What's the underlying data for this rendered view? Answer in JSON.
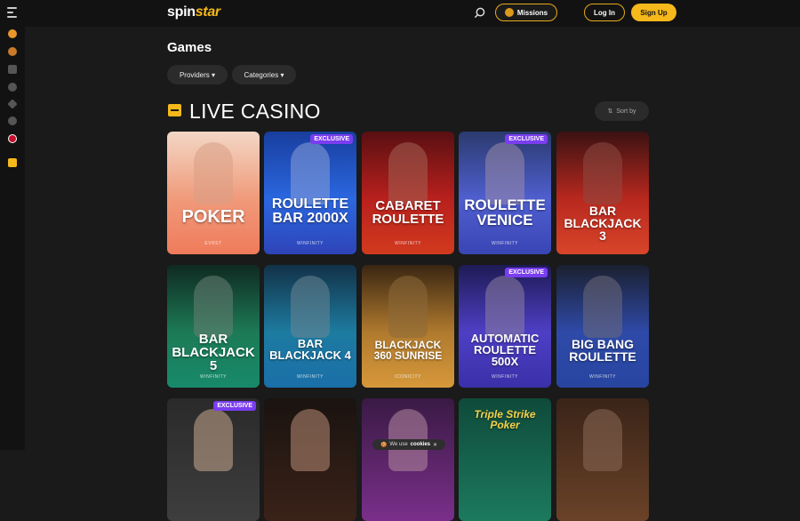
{
  "header": {
    "logo_part1": "spin",
    "logo_part2": "star",
    "missions_label": "Missions",
    "login_label": "Log In",
    "signup_label": "Sign Up"
  },
  "sidebar": {
    "icons": [
      "basketball-icon",
      "coin-icon",
      "grid-icon",
      "circle-icon",
      "diamond-icon",
      "chat-icon",
      "uk-flag-icon",
      "box-icon"
    ]
  },
  "main": {
    "title": "Games",
    "providers_label": "Providers",
    "categories_label": "Categories",
    "section_title": "LIVE CASINO",
    "sort_label": "Sort by"
  },
  "games": [
    {
      "title": "POKER",
      "brand": "EVRST",
      "badge": ""
    },
    {
      "title": "ROULETTE BAR 2000X",
      "brand": "WINFINITY",
      "badge": "EXCLUSIVE"
    },
    {
      "title": "CABARET ROULETTE",
      "brand": "WINFINITY",
      "badge": ""
    },
    {
      "title": "ROULETTE VENICE",
      "brand": "WINFINITY",
      "badge": "EXCLUSIVE"
    },
    {
      "title": "BAR BLACKJACK 3",
      "brand": "",
      "badge": ""
    },
    {
      "title": "BAR BLACKJACK 5",
      "brand": "WINFINITY",
      "badge": ""
    },
    {
      "title": "BAR BLACKJACK 4",
      "brand": "WINFINITY",
      "badge": ""
    },
    {
      "title": "BLACKJACK 360 SUNRISE",
      "brand": "ICONICITY",
      "badge": ""
    },
    {
      "title": "AUTOMATIC ROULETTE 500X",
      "brand": "WINFINITY",
      "badge": "EXCLUSIVE"
    },
    {
      "title": "BIG BANG ROULETTE",
      "brand": "WINFINITY",
      "badge": ""
    },
    {
      "title": "",
      "brand": "",
      "badge": "EXCLUSIVE"
    },
    {
      "title": "",
      "brand": "",
      "badge": ""
    },
    {
      "title": "",
      "brand": "",
      "badge": ""
    },
    {
      "title": "Triple Strike Poker",
      "brand": "",
      "badge": ""
    },
    {
      "title": "",
      "brand": "",
      "badge": ""
    }
  ],
  "cookie_text": "We use",
  "cookie_link": "cookies"
}
